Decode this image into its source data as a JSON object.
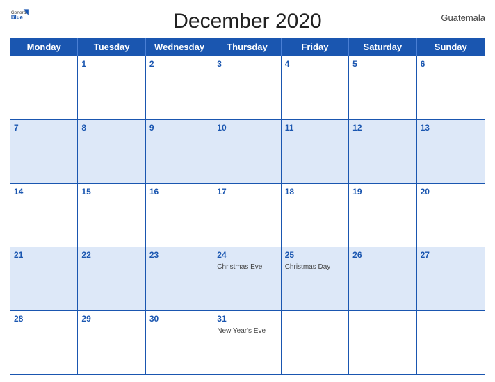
{
  "header": {
    "title": "December 2020",
    "country": "Guatemala",
    "logo_general": "General",
    "logo_blue": "Blue"
  },
  "days": [
    "Monday",
    "Tuesday",
    "Wednesday",
    "Thursday",
    "Friday",
    "Saturday",
    "Sunday"
  ],
  "weeks": [
    [
      {
        "num": "",
        "events": []
      },
      {
        "num": "1",
        "events": []
      },
      {
        "num": "2",
        "events": []
      },
      {
        "num": "3",
        "events": []
      },
      {
        "num": "4",
        "events": []
      },
      {
        "num": "5",
        "events": []
      },
      {
        "num": "6",
        "events": []
      }
    ],
    [
      {
        "num": "7",
        "events": []
      },
      {
        "num": "8",
        "events": []
      },
      {
        "num": "9",
        "events": []
      },
      {
        "num": "10",
        "events": []
      },
      {
        "num": "11",
        "events": []
      },
      {
        "num": "12",
        "events": []
      },
      {
        "num": "13",
        "events": []
      }
    ],
    [
      {
        "num": "14",
        "events": []
      },
      {
        "num": "15",
        "events": []
      },
      {
        "num": "16",
        "events": []
      },
      {
        "num": "17",
        "events": []
      },
      {
        "num": "18",
        "events": []
      },
      {
        "num": "19",
        "events": []
      },
      {
        "num": "20",
        "events": []
      }
    ],
    [
      {
        "num": "21",
        "events": []
      },
      {
        "num": "22",
        "events": []
      },
      {
        "num": "23",
        "events": []
      },
      {
        "num": "24",
        "events": [
          "Christmas Eve"
        ]
      },
      {
        "num": "25",
        "events": [
          "Christmas Day"
        ]
      },
      {
        "num": "26",
        "events": []
      },
      {
        "num": "27",
        "events": []
      }
    ],
    [
      {
        "num": "28",
        "events": []
      },
      {
        "num": "29",
        "events": []
      },
      {
        "num": "30",
        "events": []
      },
      {
        "num": "31",
        "events": [
          "New Year's Eve"
        ]
      },
      {
        "num": "",
        "events": []
      },
      {
        "num": "",
        "events": []
      },
      {
        "num": "",
        "events": []
      }
    ]
  ],
  "stripe_weeks": [
    1,
    3
  ]
}
